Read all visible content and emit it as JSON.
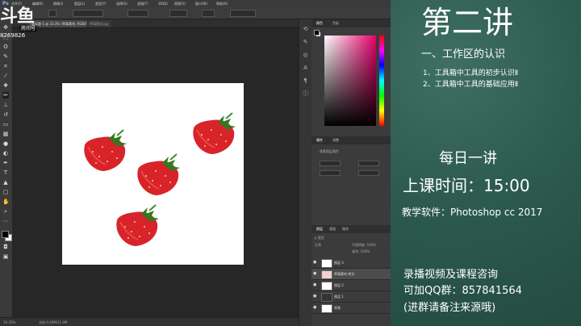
{
  "watermark": {
    "logo": "斗鱼",
    "sub": "房间号",
    "room_id": "8269826"
  },
  "ps": {
    "logo": "Ps",
    "menu": [
      "文件(F)",
      "编辑(E)",
      "图像(I)",
      "图层(L)",
      "类型(Y)",
      "选择(S)",
      "滤镜(T)",
      "3D(D)",
      "视图(V)",
      "窗口(W)",
      "帮助(H)"
    ],
    "tabs": [
      "未标题-1 @ 33.3% (草莓素材, RGB/8)",
      "草莓素材.jpg"
    ],
    "status_zoom": "16.33%",
    "status_doc": "文档:4.40M/11.4M",
    "panel_tabs_top": [
      "颜色",
      "色板"
    ],
    "panel_tabs_props": [
      "属性",
      "调整"
    ],
    "props_title": "像素图层属性",
    "panel_tabs_layers": [
      "图层",
      "通道",
      "路径"
    ],
    "layer_kind": "ρ 类型",
    "layer_mode": "正常",
    "opacity_label": "不透明度: 100%",
    "fill_label": "填充: 100%",
    "layers": [
      "图层 3",
      "草莓素材 拷贝",
      "图层 2",
      "图层 1",
      "背景"
    ]
  },
  "board": {
    "title": "第二讲",
    "section": "一、工作区的认识",
    "items": [
      "1、工具箱中工具的初步认识Ⅱ",
      "2、工具箱中工具的基础应用Ⅱ"
    ],
    "daily": "每日一讲",
    "time_label": "上课时间：15:00",
    "software": "教学软件：Photoshop cc 2017",
    "contact1": "录播视频及课程咨询",
    "contact2": "可加QQ群：857841564",
    "contact3": "(进群请备注来源哦)"
  },
  "colors": {
    "board": "#2d5b4f",
    "ps_bg": "#262626",
    "berry": "#d8232a",
    "leaf": "#2f7a1f"
  }
}
